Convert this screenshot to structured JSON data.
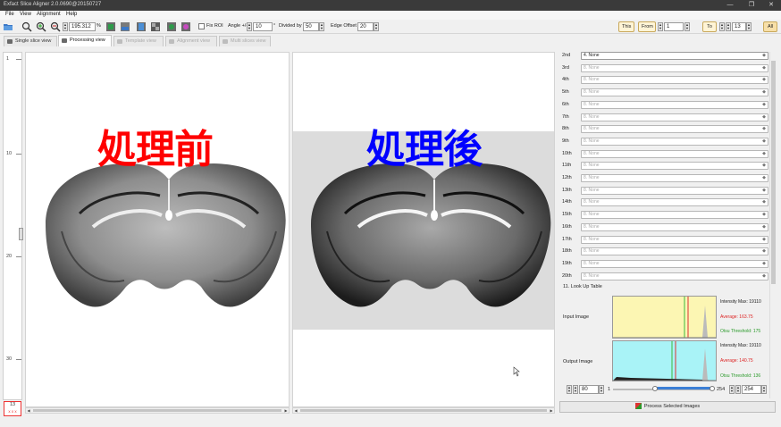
{
  "window": {
    "title": "Exfact Slice Aligner 2.0.0690@20150727",
    "controls": [
      "—",
      "❐",
      "✕"
    ]
  },
  "menu": [
    "File",
    "View",
    "Alignment",
    "Help"
  ],
  "toolbar": {
    "zoom_value": "195.312",
    "zoom_unit": "%",
    "fix_roi_label": "Fix ROI",
    "angle_label": "Angle +/-",
    "angle_value": "10",
    "angle_unit": "°",
    "divided_label": "Divided by",
    "divided_value": "50",
    "edge_label": "Edge Offset",
    "edge_value": "20",
    "this_label": "This",
    "from_label": "From",
    "from_value": "1",
    "to_label": "To",
    "to_value": "13",
    "all_label": "All"
  },
  "tabs": [
    {
      "label": "Single slice view",
      "state": "normal"
    },
    {
      "label": "Processing view",
      "state": "active"
    },
    {
      "label": "Template view",
      "state": "disabled"
    },
    {
      "label": "Alignment view",
      "state": "disabled"
    },
    {
      "label": "Multi slices view",
      "state": "disabled"
    }
  ],
  "ruler": {
    "labels": [
      "1",
      "10",
      "20",
      "30"
    ]
  },
  "slice_indicator": {
    "number": "13",
    "marks": "x x x"
  },
  "views": {
    "before_label": "処理前",
    "after_label": "処理後",
    "before_color": "#ff0000",
    "after_color": "#0000ff"
  },
  "right_panel": {
    "rows": [
      {
        "label": "2nd",
        "value": "4. None",
        "enabled": true
      },
      {
        "label": "3rd",
        "value": "8. None",
        "enabled": false
      },
      {
        "label": "4th",
        "value": "8. None",
        "enabled": false
      },
      {
        "label": "5th",
        "value": "8. None",
        "enabled": false
      },
      {
        "label": "6th",
        "value": "8. None",
        "enabled": false
      },
      {
        "label": "7th",
        "value": "8. None",
        "enabled": false
      },
      {
        "label": "8th",
        "value": "8. None",
        "enabled": false
      },
      {
        "label": "9th",
        "value": "8. None",
        "enabled": false
      },
      {
        "label": "10th",
        "value": "8. None",
        "enabled": false
      },
      {
        "label": "11th",
        "value": "8. None",
        "enabled": false
      },
      {
        "label": "12th",
        "value": "8. None",
        "enabled": false
      },
      {
        "label": "13th",
        "value": "8. None",
        "enabled": false
      },
      {
        "label": "14th",
        "value": "8. None",
        "enabled": false
      },
      {
        "label": "15th",
        "value": "8. None",
        "enabled": false
      },
      {
        "label": "16th",
        "value": "8. None",
        "enabled": false
      },
      {
        "label": "17th",
        "value": "8. None",
        "enabled": false
      },
      {
        "label": "18th",
        "value": "8. None",
        "enabled": false
      },
      {
        "label": "19th",
        "value": "8. None",
        "enabled": false
      },
      {
        "label": "20th",
        "value": "8. None",
        "enabled": false
      }
    ],
    "lut_title": "11. Look Up Table",
    "input_label": "Input Image",
    "output_label": "Output Image",
    "input_stats": {
      "max_label": "Intensity Max: 19110",
      "avg_label": "Average: 163.75",
      "otsu_label": "Otsu Threshold: 175"
    },
    "output_stats": {
      "max_label": "Intensity Max: 19110",
      "avg_label": "Average: 140.75",
      "otsu_label": "Otsu Threshold: 136"
    },
    "input_color": "#fcf6b3",
    "output_color": "#a9f3f7",
    "lut_low": "80",
    "lut_one": "1",
    "lut_max": "254",
    "lut_high": "254",
    "process_label": "Process Selected Images"
  }
}
